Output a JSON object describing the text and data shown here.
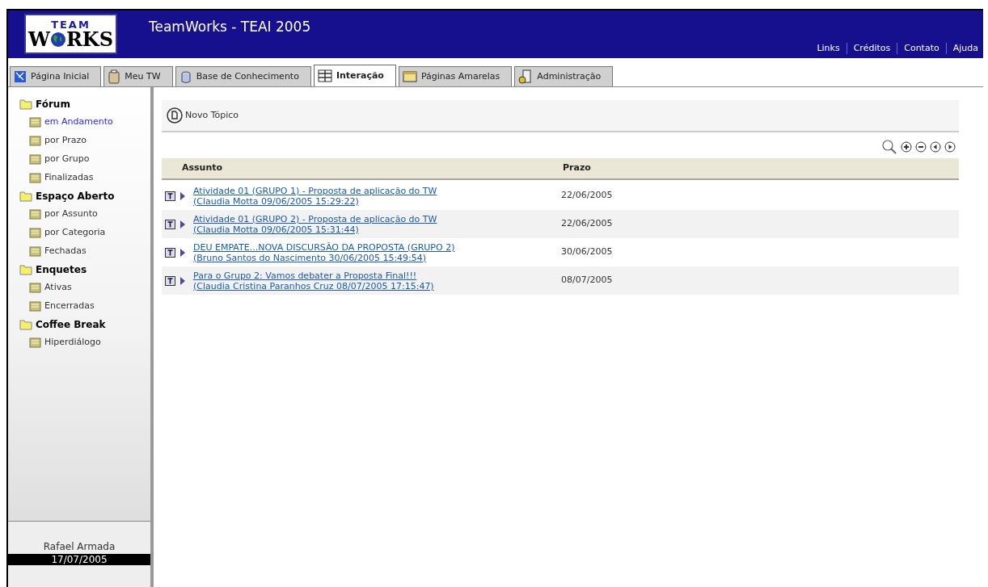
{
  "header": {
    "logo_top": "TEAM",
    "logo_bottom": "W",
    "logo_bottom_end": "RKS",
    "title": "TeamWorks - TEAI 2005",
    "links": [
      "Links",
      "Créditos",
      "Contato",
      "Ajuda"
    ]
  },
  "tabs": [
    {
      "label": "Página Inicial",
      "selected": false
    },
    {
      "label": "Meu TW",
      "selected": false
    },
    {
      "label": "Base de Conhecimento",
      "selected": false
    },
    {
      "label": "Interação",
      "selected": true
    },
    {
      "label": "Páginas Amarelas",
      "selected": false
    },
    {
      "label": "Administração",
      "selected": false
    }
  ],
  "sidebar": {
    "groups": [
      {
        "label": "Fórum",
        "children": [
          {
            "label": "em Andamento",
            "selected": true
          },
          {
            "label": "por Prazo",
            "selected": false
          },
          {
            "label": "por Grupo",
            "selected": false
          },
          {
            "label": "Finalizadas",
            "selected": false
          }
        ]
      },
      {
        "label": "Espaço Aberto",
        "children": [
          {
            "label": "por Assunto",
            "selected": false
          },
          {
            "label": "por Categoria",
            "selected": false
          },
          {
            "label": "Fechadas",
            "selected": false
          }
        ]
      },
      {
        "label": "Enquetes",
        "children": [
          {
            "label": "Ativas",
            "selected": false
          },
          {
            "label": "Encerradas",
            "selected": false
          }
        ]
      },
      {
        "label": "Coffee Break",
        "children": [
          {
            "label": "Hiperdiálogo",
            "selected": false
          }
        ]
      }
    ],
    "user": "Rafael Armada",
    "date": "17/07/2005"
  },
  "toolbar": {
    "new_topic": "Novo Tópico"
  },
  "table": {
    "columns": [
      "Assunto",
      "Prazo"
    ],
    "rows": [
      {
        "title": "Atividade 01 (GRUPO 1) - Proposta de aplicação do TW",
        "author": "(Claudia Motta 09/06/2005 15:29:22)",
        "deadline": "22/06/2005"
      },
      {
        "title": "Atividade 01 (GRUPO 2) - Proposta de aplicação do TW",
        "author": "(Claudia Motta 09/06/2005 15:31:44)",
        "deadline": "22/06/2005"
      },
      {
        "title": "DEU EMPATE...NOVA DISCURSÃO DA PROPOSTA (GRUPO 2)",
        "author": "(Bruno Santos do Nascimento 30/06/2005 15:49:54)",
        "deadline": "30/06/2005"
      },
      {
        "title": "Para o Grupo 2: Vamos debater a Proposta Final!!!",
        "author": "(Claudia Cristina Paranhos Cruz 08/07/2005 17:15:47)",
        "deadline": "08/07/2005"
      }
    ]
  }
}
